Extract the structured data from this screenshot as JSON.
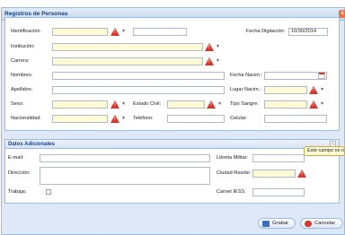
{
  "window": {
    "title": "Registros de Personas",
    "close_glyph": "x"
  },
  "form": {
    "identificacion_label": "Identificación",
    "fecha_digitacion_label": "Fecha Digitación:",
    "fecha_digitacion_value": "10/30/2014",
    "institucion_label": "Institución:",
    "carrera_label": "Carrera:",
    "nombres_label": "Nombres:",
    "fecha_nacim_label": "Fecha Nacim.:",
    "apellidos_label": "Apellidos:",
    "lugar_nacim_label": "Lugar Nacim.:",
    "sexo_label": "Sexo:",
    "estado_civil_label": "Estado Civil:",
    "tipo_sangre_label": "Tipo Sangre:",
    "nacionalidad_label": "Nacionalidad:",
    "telefono_label": "Teléfono:",
    "celular_label": "Celular:"
  },
  "adicionales": {
    "title": "Datos Adicionales",
    "collapse_glyph": "»",
    "email_label": "E-mail:",
    "libreta_label": "Libreta Militar:",
    "direccion_label": "Dirección:",
    "ciudad_label": "Ciudad Reside:",
    "trabaja_label": "Trabaja:",
    "carnet_label": "Carnet IESS:",
    "tooltip": "Este campo es obligatorio"
  },
  "buttons": {
    "grabar": "Grabar",
    "cancelar": "Cancelar"
  },
  "icons": {
    "chevron": "▾"
  },
  "colors": {
    "required_bg": "#fffbd6",
    "warn": "#d8372c",
    "header": "#15428b"
  }
}
